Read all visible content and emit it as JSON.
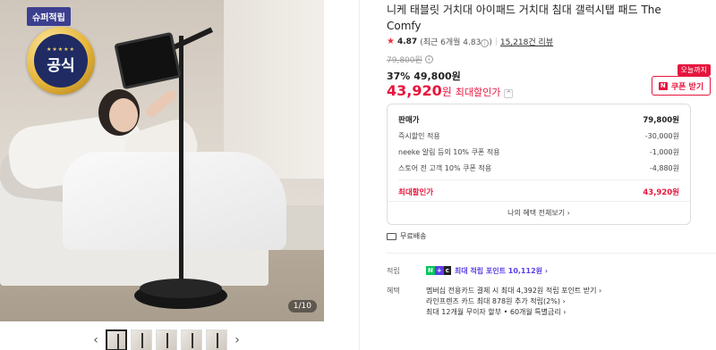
{
  "gallery": {
    "badge_super": "슈퍼적립",
    "medal_text": "공식",
    "medal_stars": "★★★★★",
    "page_indicator": "1/10",
    "prev_arrow": "‹",
    "next_arrow": "›",
    "thumbnail_count": 5
  },
  "product": {
    "title": "니케 태블릿 거치대 아이패드 거치대 침대 갤럭시탭 패드 The Comfy",
    "rating": "4.87",
    "rating_detail": "(최근 6개월 4.83",
    "rating_detail_close": ")",
    "review_count": "15,218건 리뷰",
    "original_price": "79,800원",
    "discount_rate": "37%",
    "discount_price": "49,800원",
    "sale_price": "43,920",
    "sale_unit": "원",
    "sale_label": "최대할인가",
    "coupon_badge": "오늘까지",
    "coupon_button": "쿠폰 받기",
    "coupon_icon": "N"
  },
  "price_breakdown": {
    "rows": [
      {
        "label": "판매가",
        "value": "79,800원"
      },
      {
        "label": "즉시할인 적용",
        "value": "-30,000원"
      },
      {
        "label": "neeke 알림 등의 10% 쿠폰 적용",
        "value": "-1,000원"
      },
      {
        "label": "스토어 전 고객 10% 쿠폰 적용",
        "value": "-4,880원"
      }
    ],
    "total_label": "최대할인가",
    "total_value": "43,920원",
    "more_link": "나의 혜택 전체보기 ›"
  },
  "shipping": {
    "label": "무료배송"
  },
  "benefits": {
    "points_label": "적립",
    "points_badge_n": "N",
    "points_badge_plus": "+",
    "points_badge_card": "c",
    "points_text": "최대 적립 포인트 10,112원 ›",
    "benefit_label": "혜택",
    "benefit_lines": [
      "멤버십 전용카드 결제 시 최대 4,392원 적립 포인트 받기 ›",
      "라인프렌즈 카드 최대 878원 추가 적립(2%) ›",
      "최대 12개월 무이자 할부 • 60개월 특별금리 ›"
    ]
  },
  "colors": {
    "accent_red": "#e6163e",
    "naver_green": "#03c75a",
    "points_purple": "#5b3ee6"
  }
}
